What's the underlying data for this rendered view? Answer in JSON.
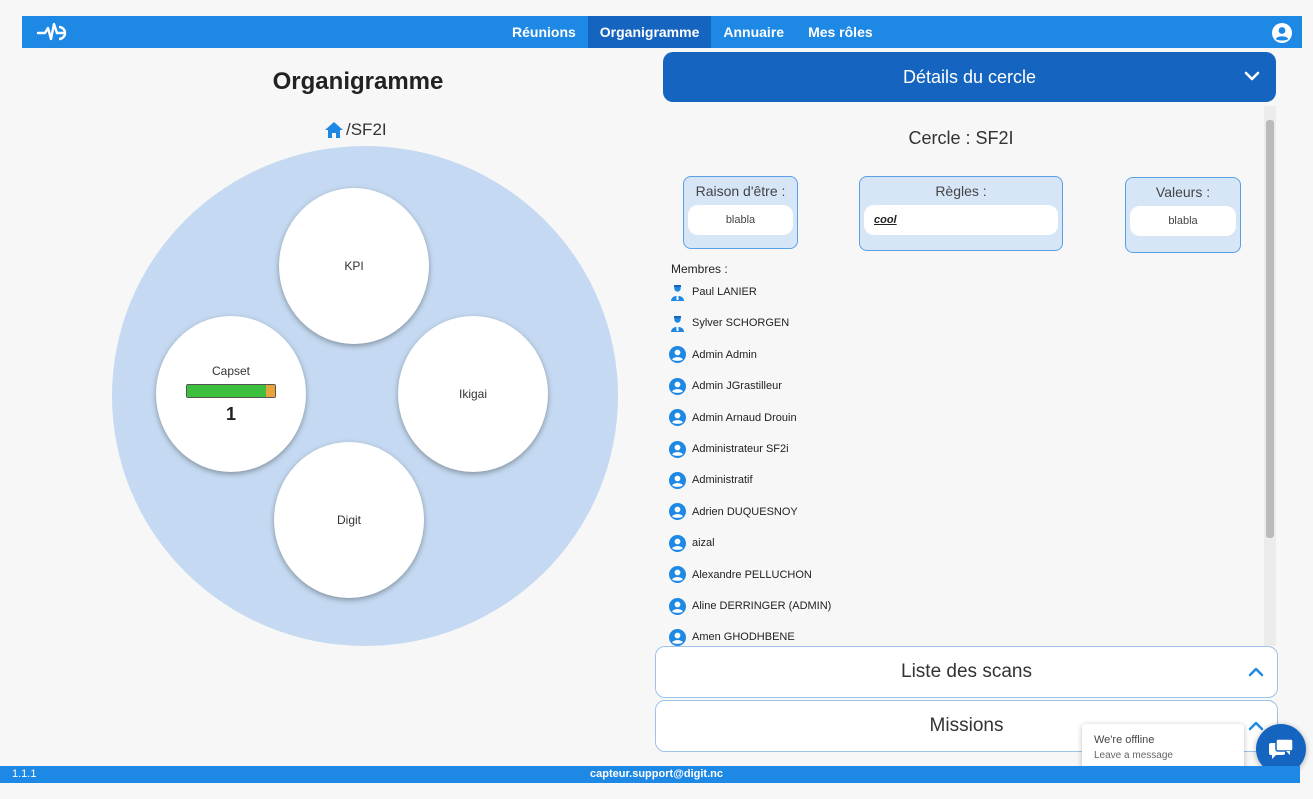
{
  "nav": {
    "items": [
      {
        "label": "Réunions",
        "active": false
      },
      {
        "label": "Organigramme",
        "active": true
      },
      {
        "label": "Annuaire",
        "active": false
      },
      {
        "label": "Mes rôles",
        "active": false
      }
    ]
  },
  "left": {
    "title": "Organigramme",
    "breadcrumb": "/SF2I",
    "circles": [
      {
        "label": "KPI"
      },
      {
        "label": "Capset",
        "progress_fraction": 0.9,
        "count": "1"
      },
      {
        "label": "Ikigai"
      },
      {
        "label": "Digit"
      }
    ]
  },
  "details": {
    "header": "Détails du cercle",
    "circle_name": "Cercle : SF2I",
    "raison": {
      "label": "Raison d'être :",
      "value": "blabla"
    },
    "regles": {
      "label": "Règles :",
      "value": "cool"
    },
    "valeurs": {
      "label": "Valeurs :",
      "value": "blabla"
    },
    "members_title": "Membres :",
    "members": [
      {
        "name": "Paul LANIER",
        "icon": "person-badge-icon"
      },
      {
        "name": "Sylver SCHORGEN",
        "icon": "person-badge-icon"
      },
      {
        "name": "Admin Admin",
        "icon": "account-circle-icon"
      },
      {
        "name": "Admin JGrastilleur",
        "icon": "account-circle-icon"
      },
      {
        "name": "Admin Arnaud Drouin",
        "icon": "account-circle-icon"
      },
      {
        "name": "Administrateur SF2i",
        "icon": "account-circle-icon"
      },
      {
        "name": "Administratif",
        "icon": "account-circle-icon"
      },
      {
        "name": "Adrien DUQUESNOY",
        "icon": "account-circle-icon"
      },
      {
        "name": "aizal",
        "icon": "account-circle-icon"
      },
      {
        "name": "Alexandre PELLUCHON",
        "icon": "account-circle-icon"
      },
      {
        "name": "Aline DERRINGER (ADMIN)",
        "icon": "account-circle-icon"
      },
      {
        "name": "Amen GHODHBENE",
        "icon": "account-circle-icon"
      }
    ]
  },
  "accordions": {
    "scans": "Liste des scans",
    "missions": "Missions"
  },
  "chat": {
    "status": "We're offline",
    "action": "Leave a message"
  },
  "footer": {
    "version": "1.1.1",
    "support": "capteur.support@digit.nc"
  },
  "colors": {
    "primary": "#1e88e5",
    "primary_dark": "#1565c0",
    "circle_bg": "#c5daf2",
    "progress_green": "#3cbf3c",
    "progress_orange": "#e8a33a"
  }
}
